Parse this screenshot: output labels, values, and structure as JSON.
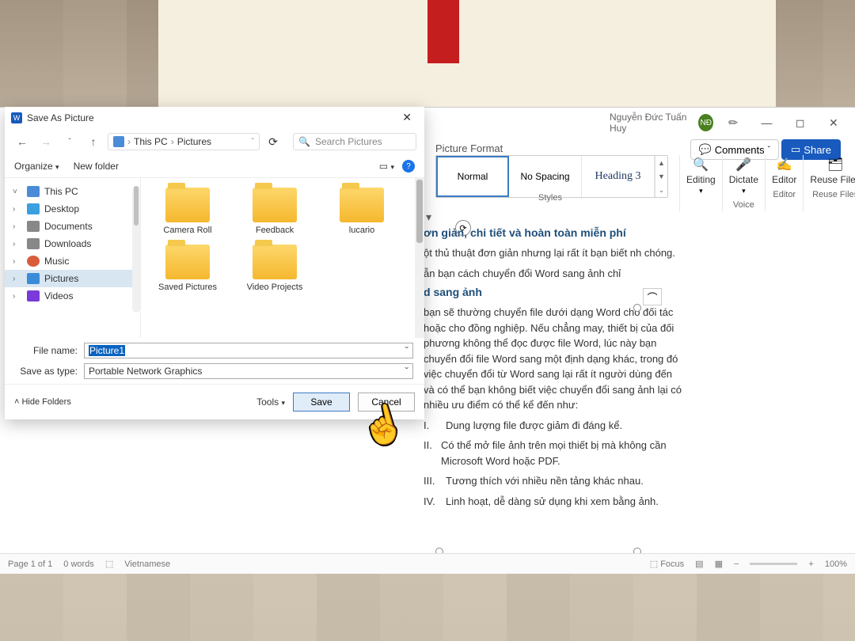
{
  "word": {
    "user_name": "Nguyễn Đức Tuấn Huy",
    "avatar": "NĐ",
    "comments": "Comments",
    "share": "Share",
    "picture_format": "Picture Format",
    "styles": {
      "normal": "Normal",
      "nospacing": "No Spacing",
      "heading3": "Heading 3",
      "label": "Styles"
    },
    "groups": {
      "editing": "Editing",
      "dictate": "Dictate",
      "editor": "Editor",
      "reuse": "Reuse Files",
      "voice": "Voice",
      "editor_cat": "Editor",
      "reuse_cat": "Reuse Files"
    },
    "statusbar": {
      "page": "Page 1 of 1",
      "words": "0 words",
      "lang": "Vietnamese",
      "focus": "Focus",
      "zoom": "100%"
    }
  },
  "doc": {
    "h1": "ơn giản, chi tiết và hoàn toàn miễn phí",
    "p1": "ột thủ thuật đơn giản nhưng lại rất ít bạn biết nh chóng.",
    "p2": "ẫn bạn cách chuyển đổi Word sang ảnh chỉ",
    "h2": "d sang ảnh",
    "p3": "bạn sẽ thường chuyển file dưới dạng Word cho đối tác hoặc cho đồng nghiệp. Nếu chẳng may, thiết bị của đối phương không thể đọc được file Word, lúc này bạn chuyển đổi file Word sang một định dạng khác, trong đó việc chuyển đổi từ Word sang lại rất ít người dùng đến và có thể bạn không biết việc chuyển đổi sang ảnh lại có nhiều ưu điểm có thể kể đến như:",
    "li1": "Dung lượng file được giảm đi đáng kể.",
    "li2": "Có thể mở file ảnh trên mọi thiết bị mà không cần Microsoft Word hoặc PDF.",
    "li3": "Tương thích với nhiều nền tảng khác nhau.",
    "li4": "Linh hoạt, dễ dàng sử dụng khi xem bằng ảnh."
  },
  "dialog": {
    "title": "Save As Picture",
    "breadcrumb": {
      "pc": "This PC",
      "pictures": "Pictures"
    },
    "search_placeholder": "Search Pictures",
    "organize": "Organize",
    "new_folder": "New folder",
    "tree": {
      "thispc": "This PC",
      "desktop": "Desktop",
      "documents": "Documents",
      "downloads": "Downloads",
      "music": "Music",
      "pictures": "Pictures",
      "videos": "Videos"
    },
    "folders": [
      "Camera Roll",
      "Feedback",
      "lucario",
      "Saved Pictures",
      "Video Projects"
    ],
    "filename_label": "File name:",
    "filename_value": "Picture1",
    "type_label": "Save as type:",
    "type_value": "Portable Network Graphics",
    "hide_folders": "Hide Folders",
    "tools": "Tools",
    "save": "Save",
    "cancel": "Cancel"
  }
}
